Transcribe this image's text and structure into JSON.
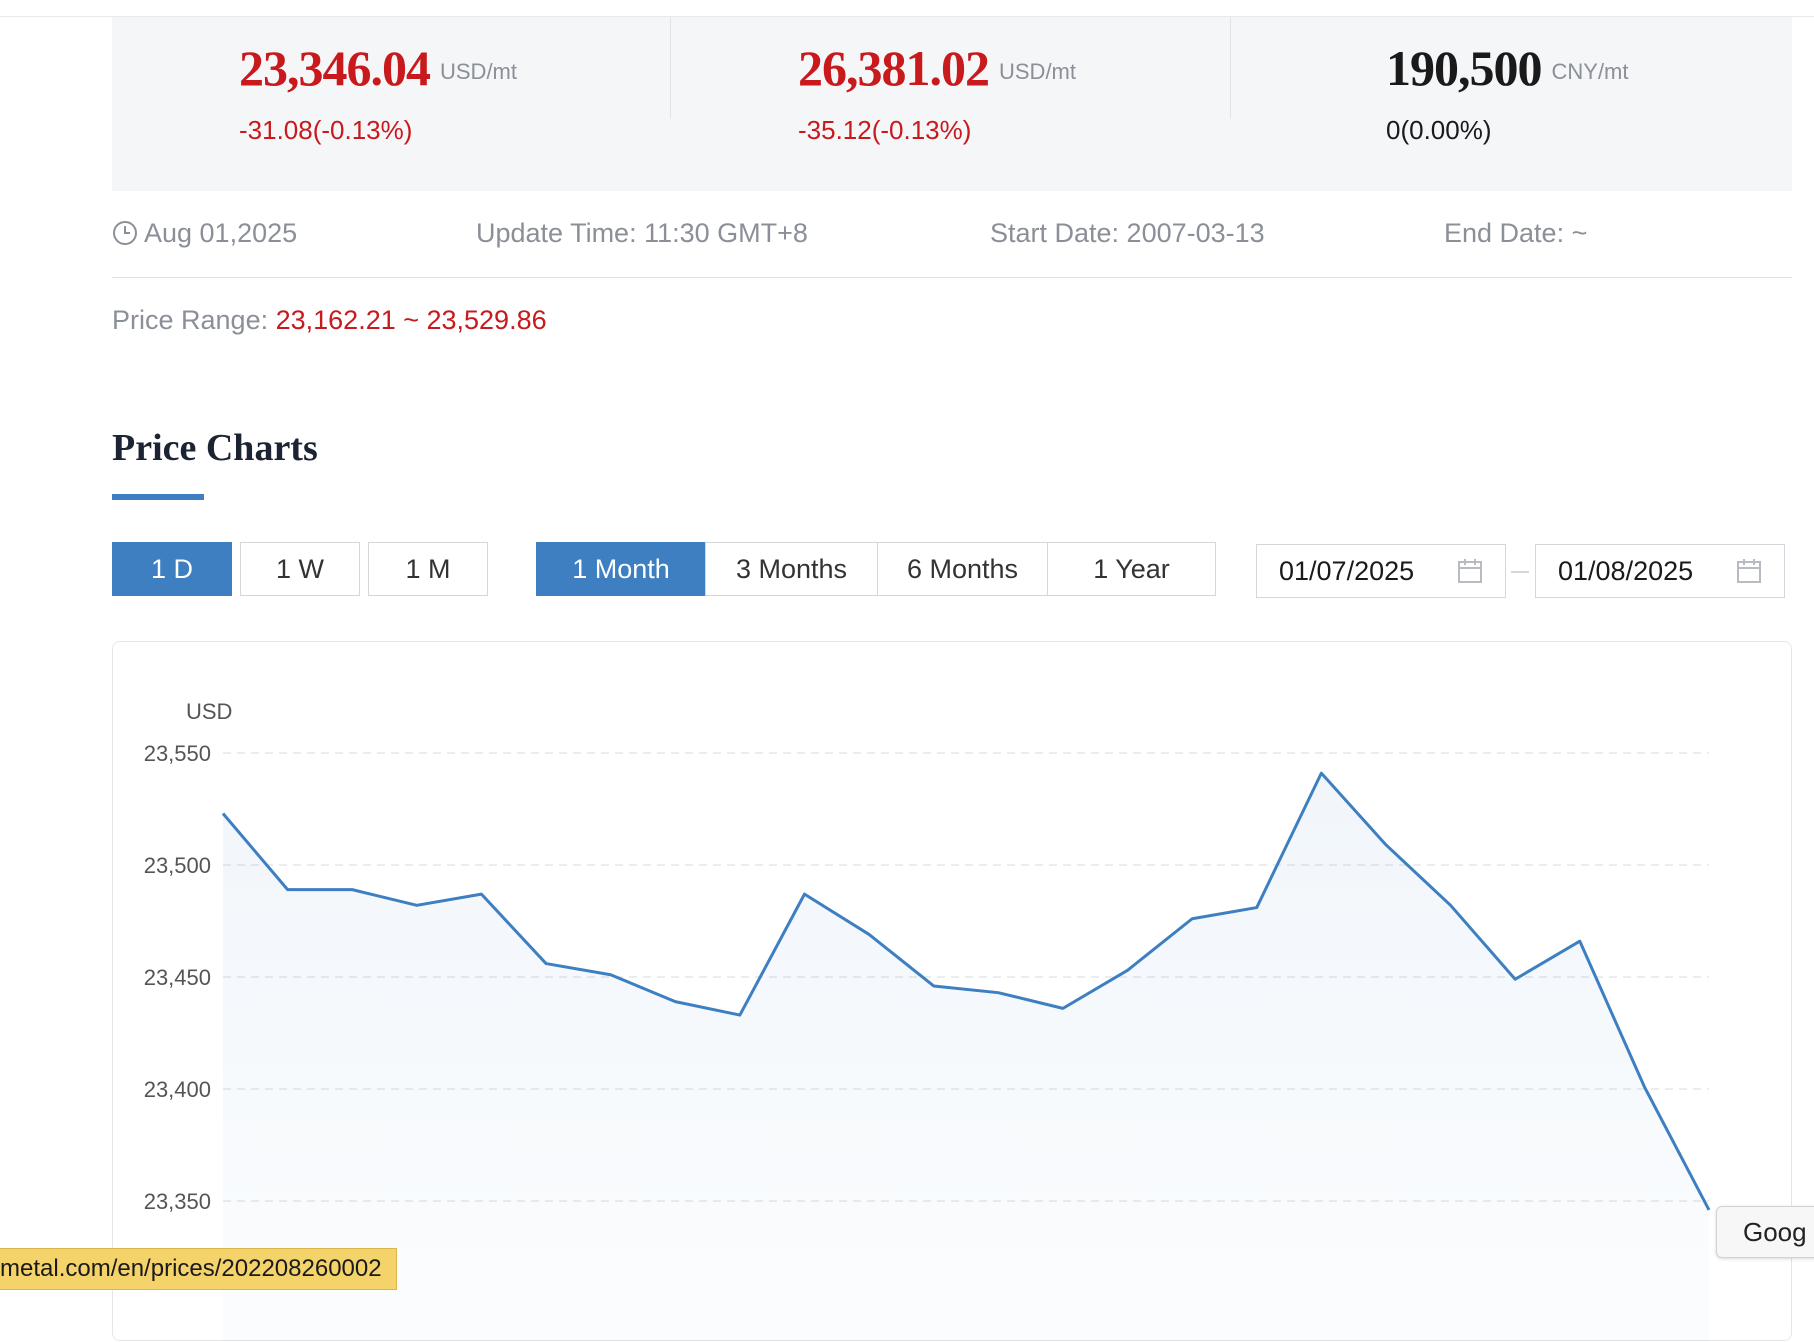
{
  "prices": [
    {
      "value": "23,346.04",
      "unit": "USD/mt",
      "change": "-31.08(-0.13%)",
      "tone": "red"
    },
    {
      "value": "26,381.02",
      "unit": "USD/mt",
      "change": "-35.12(-0.13%)",
      "tone": "red"
    },
    {
      "value": "190,500",
      "unit": "CNY/mt",
      "change": "0(0.00%)",
      "tone": "black"
    }
  ],
  "meta": {
    "date": "Aug 01,2025",
    "update_time": "Update Time: 11:30 GMT+8",
    "start_date": "Start Date: 2007-03-13",
    "end_date": "End Date: ~"
  },
  "price_range": {
    "label": "Price Range:",
    "value": "23,162.21 ~ 23,529.86"
  },
  "section_title": "Price Charts",
  "interval_buttons": [
    "1 D",
    "1 W",
    "1 M"
  ],
  "period_buttons": [
    "1 Month",
    "3 Months",
    "6 Months",
    "1 Year"
  ],
  "date_range": {
    "from": "01/07/2025",
    "to": "01/08/2025"
  },
  "colors": {
    "accent": "#3d7fc1",
    "down": "#c8191c",
    "line": "#3d7fc1"
  },
  "icons": {
    "clock": "clock-icon",
    "calendar": "calendar-icon"
  },
  "status_url": "metal.com/en/prices/202208260002",
  "overlay_tab": "Goog",
  "chart_data": {
    "type": "line",
    "ylabel": "USD",
    "ylim": [
      23350,
      23550
    ],
    "yticks": [
      23550,
      23500,
      23450,
      23400,
      23350
    ],
    "ytick_labels": [
      "23,550",
      "23,500",
      "23,450",
      "23,400",
      "23,350"
    ],
    "grid": true,
    "series": [
      {
        "values": [
          23523,
          23489,
          23489,
          23482,
          23487,
          23456,
          23451,
          23439,
          23433,
          23487,
          23469,
          23446,
          23443,
          23436,
          23453,
          23476,
          23481,
          23541,
          23509,
          23482,
          23449,
          23466,
          23401,
          23346
        ]
      }
    ]
  }
}
